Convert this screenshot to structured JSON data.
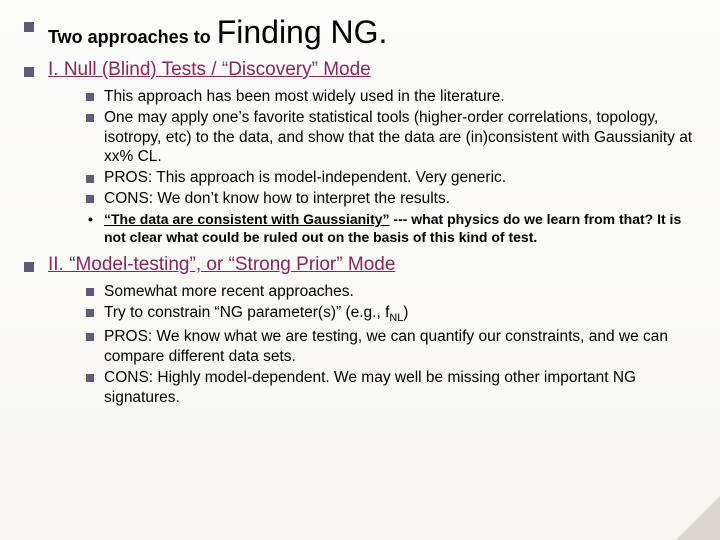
{
  "title": {
    "prefix": "Two approaches to",
    "main": "Finding NG."
  },
  "sections": [
    {
      "heading": "I. Null (Blind) Tests / “Discovery” Mode",
      "bullets": [
        "This approach has been most widely used in the literature.",
        "One may apply one’s favorite statistical tools (higher-order correlations, topology, isotropy, etc) to the data, and show that the data are (in)consistent with Gaussianity at xx% CL.",
        "PROS: This approach is model-independent. Very generic.",
        "CONS: We don’t know how to interpret the results."
      ],
      "sub": [
        {
          "quote": "“The data are consistent with Gaussianity”",
          "rest": " --- what physics do we learn from that? It is not clear what could be ruled out on the basis of this kind of test."
        }
      ]
    },
    {
      "heading": "II. “Model-testing”, or “Strong Prior” Mode",
      "bullets": [
        "Somewhat more recent approaches.",
        "Try to constrain “NG parameter(s)” (e.g., f",
        "PROS: We know what we are testing, we can quantify our constraints, and we can compare different data sets.",
        "CONS: Highly model-dependent. We may well be missing other important NG signatures."
      ],
      "param_sub": "NL",
      "param_tail": ")"
    }
  ]
}
